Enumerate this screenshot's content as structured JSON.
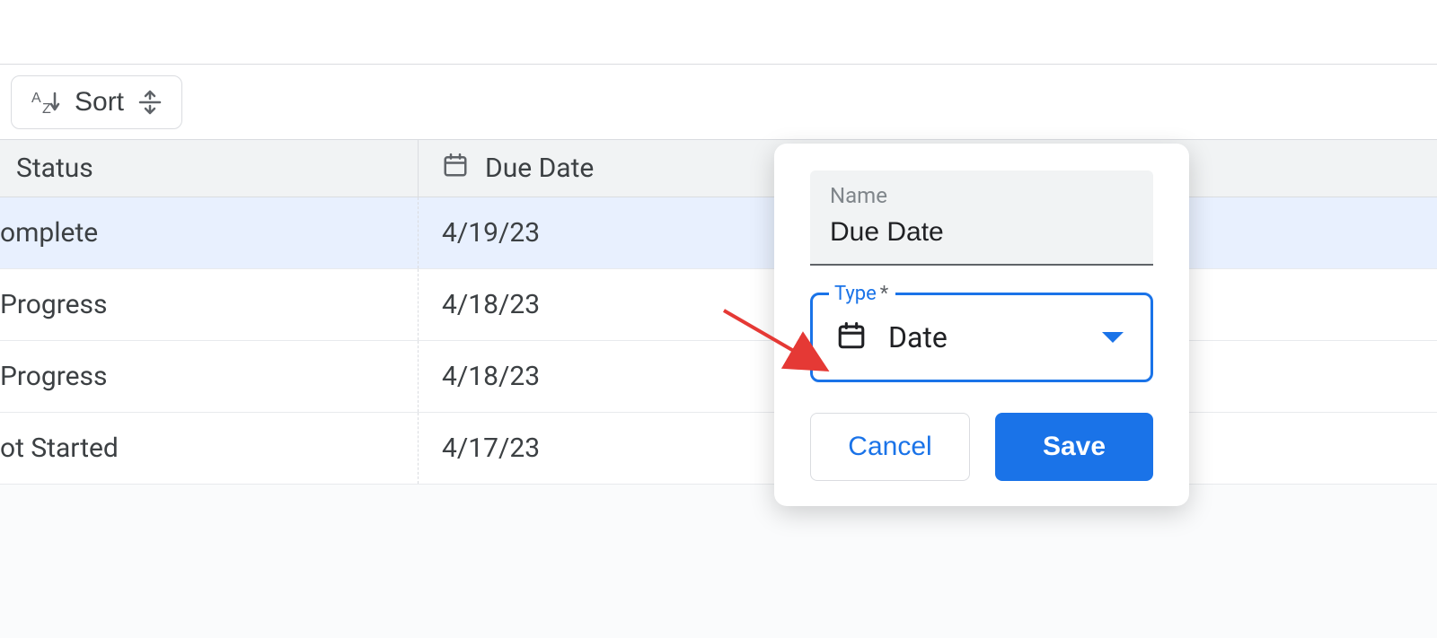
{
  "toolbar": {
    "sort_label": "Sort"
  },
  "grid": {
    "headers": {
      "status": "Status",
      "due_date": "Due Date"
    },
    "rows": [
      {
        "status": "omplete",
        "due_date": "4/19/23",
        "selected": true
      },
      {
        "status": "Progress",
        "due_date": "4/18/23",
        "selected": false
      },
      {
        "status": "Progress",
        "due_date": "4/18/23",
        "selected": false
      },
      {
        "status": "ot Started",
        "due_date": "4/17/23",
        "selected": false
      }
    ]
  },
  "popover": {
    "name_label": "Name",
    "name_value": "Due Date",
    "type_label": "Type",
    "type_required_mark": "*",
    "type_value": "Date",
    "cancel_label": "Cancel",
    "save_label": "Save"
  }
}
